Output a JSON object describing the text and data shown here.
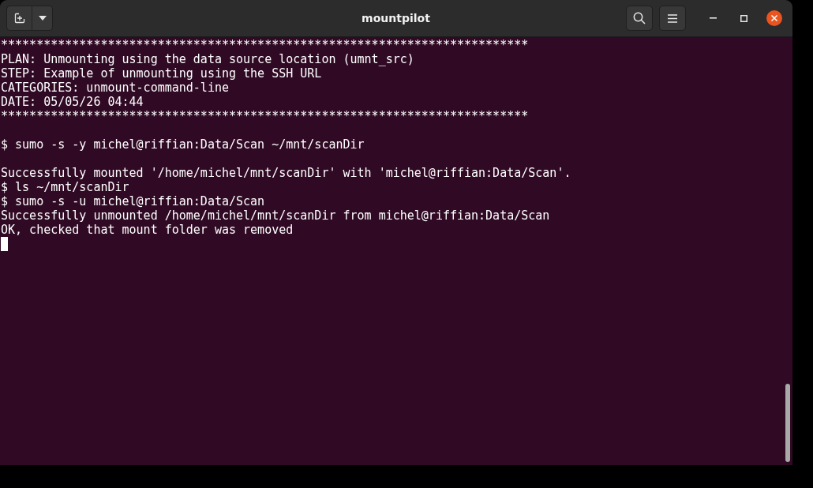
{
  "window": {
    "title": "mountpilot"
  },
  "terminal": {
    "lines": [
      {
        "kind": "text",
        "text": "**************************************************************************"
      },
      {
        "kind": "text",
        "text": "PLAN: Unmounting using the data source location (umnt_src)"
      },
      {
        "kind": "text",
        "text": "STEP: Example of unmounting using the SSH URL"
      },
      {
        "kind": "text",
        "text": "CATEGORIES: unmount-command-line"
      },
      {
        "kind": "text",
        "text": "DATE: 05/05/26 04:44"
      },
      {
        "kind": "text",
        "text": "**************************************************************************"
      },
      {
        "kind": "blank"
      },
      {
        "kind": "text",
        "text": "$ sumo -s -y michel@riffian:Data/Scan ~/mnt/scanDir"
      },
      {
        "kind": "blank"
      },
      {
        "kind": "text",
        "text": "Successfully mounted '/home/michel/mnt/scanDir' with 'michel@riffian:Data/Scan'."
      },
      {
        "kind": "text",
        "text": "$ ls ~/mnt/scanDir"
      },
      {
        "kind": "text",
        "text": "$ sumo -s -u michel@riffian:Data/Scan"
      },
      {
        "kind": "text",
        "text": "Successfully unmounted /home/michel/mnt/scanDir from michel@riffian:Data/Scan"
      },
      {
        "kind": "text",
        "text": "OK, checked that mount folder was removed"
      },
      {
        "kind": "cursor"
      }
    ]
  }
}
